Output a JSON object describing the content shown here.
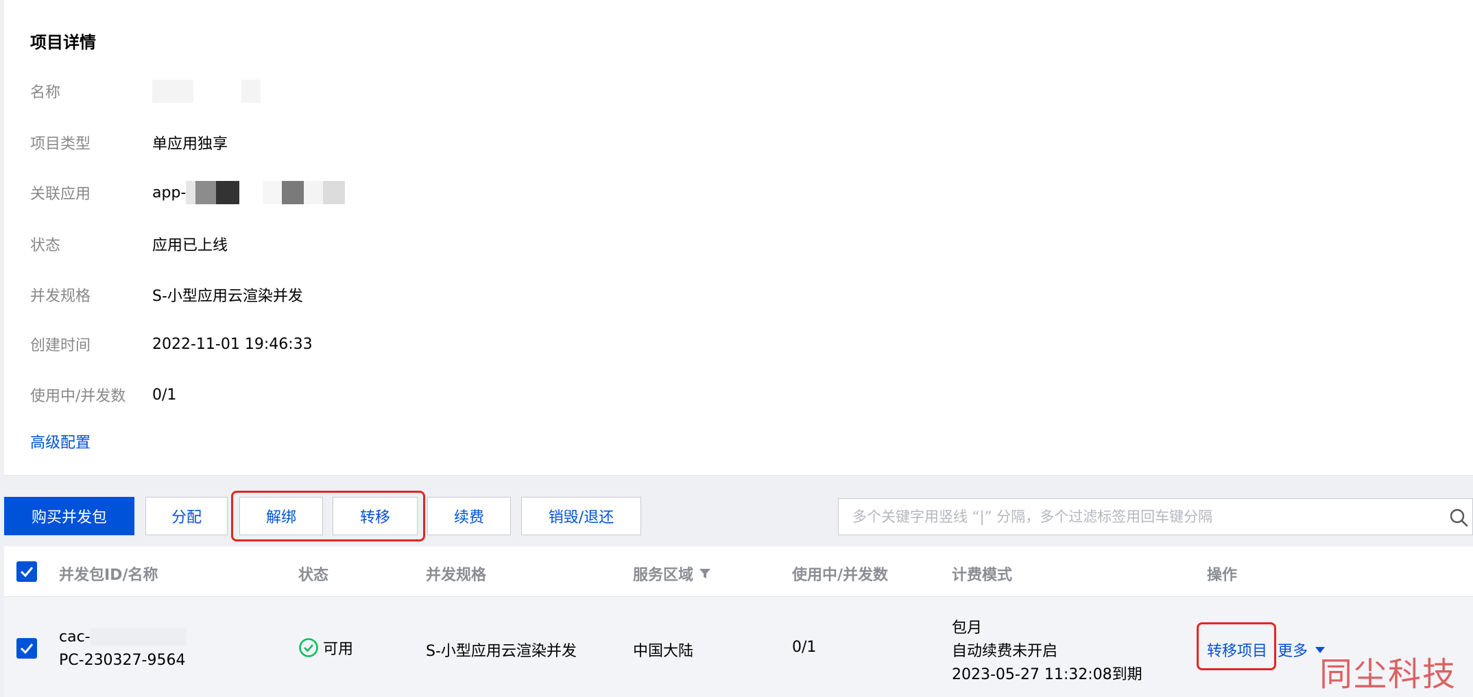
{
  "detail": {
    "title": "项目详情",
    "fields": [
      {
        "label": "名称",
        "value": ""
      },
      {
        "label": "项目类型",
        "value": "单应用独享"
      },
      {
        "label": "关联应用",
        "value": "app-"
      },
      {
        "label": "状态",
        "value": "应用已上线"
      },
      {
        "label": "并发规格",
        "value": "S-小型应用云渲染并发"
      },
      {
        "label": "创建时间",
        "value": "2022-11-01 19:46:33"
      },
      {
        "label": "使用中/并发数",
        "value": "0/1"
      }
    ],
    "advanced_link": "高级配置"
  },
  "toolbar": {
    "buy": "购买并发包",
    "assign": "分配",
    "unbind": "解绑",
    "transfer": "转移",
    "renew": "续费",
    "destroy": "销毁/退还",
    "search_placeholder": "多个关键字用竖线 “|” 分隔，多个过滤标签用回车键分隔"
  },
  "table": {
    "headers": {
      "id": "并发包ID/名称",
      "status": "状态",
      "spec": "并发规格",
      "region": "服务区域",
      "usage": "使用中/并发数",
      "billing": "计费模式",
      "actions": "操作"
    },
    "rows": [
      {
        "id": "cac-",
        "name": "PC-230327-9564",
        "status": "可用",
        "spec": "S-小型应用云渲染并发",
        "region": "中国大陆",
        "usage": "0/1",
        "billing_mode": "包月",
        "auto_renew": "自动续费未开启",
        "expire": "2023-05-27 11:32:08到期",
        "action_transfer": "转移项目",
        "action_more": "更多"
      }
    ]
  },
  "watermark": "同尘科技",
  "colors": {
    "accent": "#0052d9",
    "highlight": "#e3261f",
    "success": "#0abf5b"
  }
}
